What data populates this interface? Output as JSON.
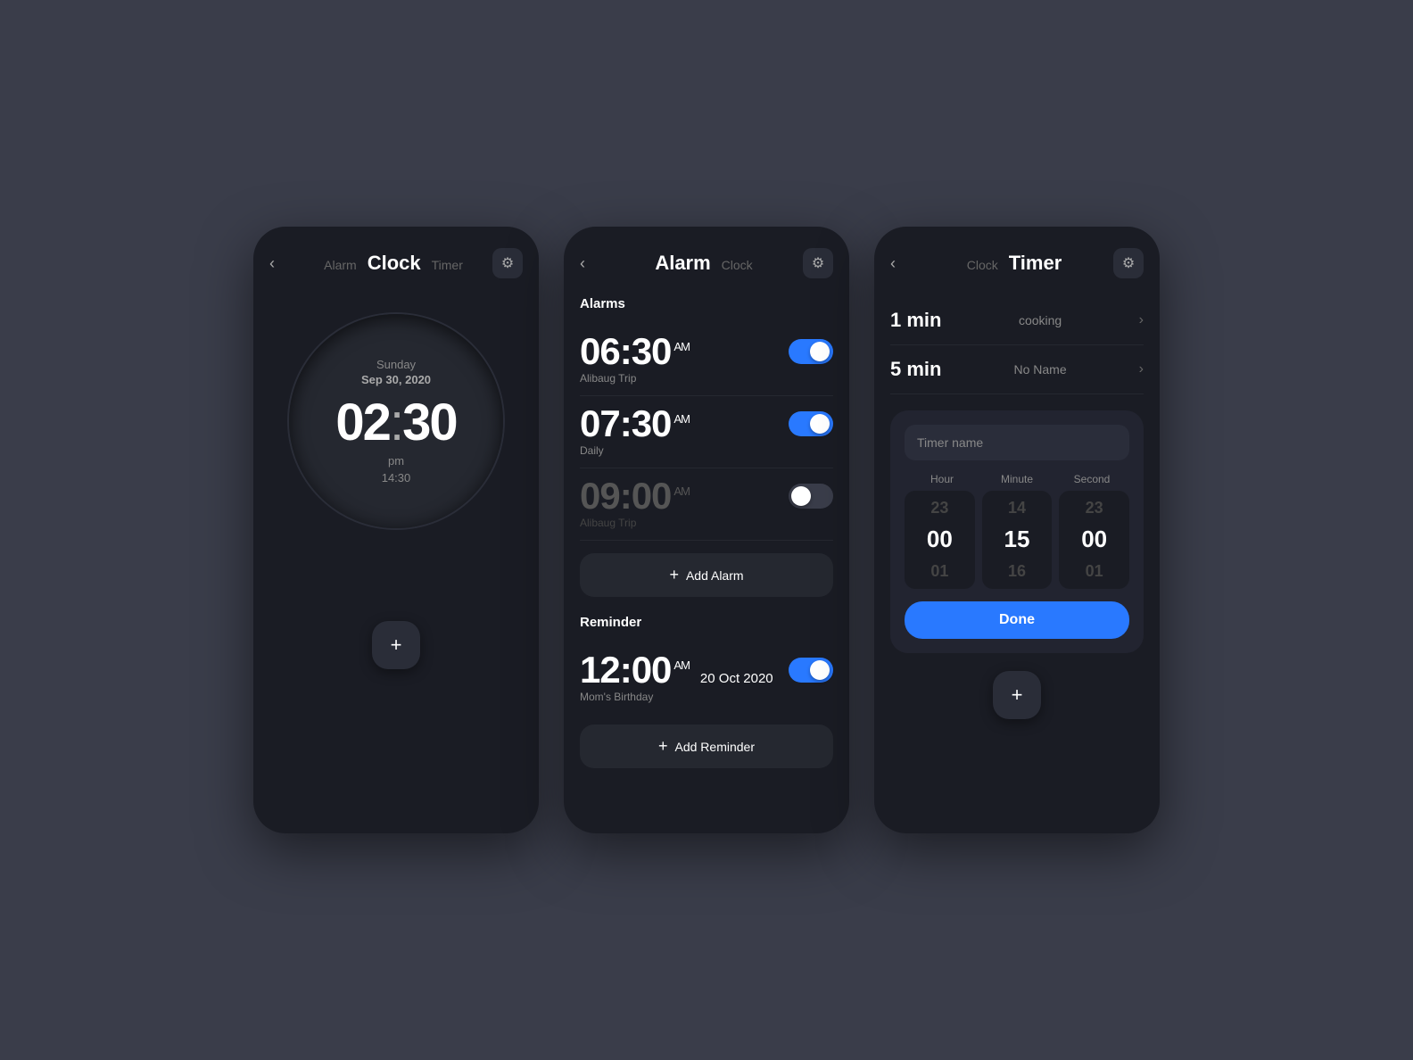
{
  "screen1": {
    "nav": {
      "back_icon": "‹",
      "tabs": [
        {
          "label": "Alarm",
          "active": false
        },
        {
          "label": "Clock",
          "active": true
        },
        {
          "label": "Timer",
          "active": false
        }
      ],
      "settings_icon": "⚙"
    },
    "clock": {
      "day": "Sunday",
      "date": "Sep 30, 2020",
      "time": "02",
      "colon": ":",
      "minutes": "30",
      "period": "pm",
      "time_24h": "14:30"
    },
    "fab_icon": "+"
  },
  "screen2": {
    "nav": {
      "back_icon": "‹",
      "tabs": [
        {
          "label": "Alarm",
          "active": true
        },
        {
          "label": "Clock",
          "active": false
        }
      ],
      "settings_icon": "⚙"
    },
    "alarms_section": "Alarms",
    "alarms": [
      {
        "time": "06:30",
        "am_pm": "AM",
        "label": "Alibaug Trip",
        "on": true,
        "dimmed": false
      },
      {
        "time": "07:30",
        "am_pm": "AM",
        "label": "Daily",
        "on": true,
        "dimmed": false
      },
      {
        "time": "09:00",
        "am_pm": "AM",
        "label": "Alibaug Trip",
        "on": false,
        "dimmed": true
      }
    ],
    "add_alarm": "+ Add Alarm",
    "reminder_section": "Reminder",
    "reminders": [
      {
        "time": "12:00",
        "am_pm": "AM",
        "date": "20 Oct 2020",
        "label": "Mom's Birthday",
        "on": true
      }
    ],
    "add_reminder": "+ Add Reminder"
  },
  "screen3": {
    "nav": {
      "back_icon": "‹",
      "tabs": [
        {
          "label": "Clock",
          "active": false
        },
        {
          "label": "Timer",
          "active": true
        }
      ],
      "settings_icon": "⚙"
    },
    "timers": [
      {
        "duration": "1 min",
        "name": "cooking"
      },
      {
        "duration": "5 min",
        "name": "No Name"
      }
    ],
    "modal": {
      "name_placeholder": "Timer name",
      "cols": [
        {
          "label": "Hour",
          "above": "23",
          "selected": "00",
          "below": "01"
        },
        {
          "label": "Minute",
          "above": "14",
          "selected": "15",
          "below": "16"
        },
        {
          "label": "Second",
          "above": "23",
          "selected": "00",
          "below": "01"
        }
      ],
      "done_button": "Done"
    },
    "fab_icon": "+"
  }
}
